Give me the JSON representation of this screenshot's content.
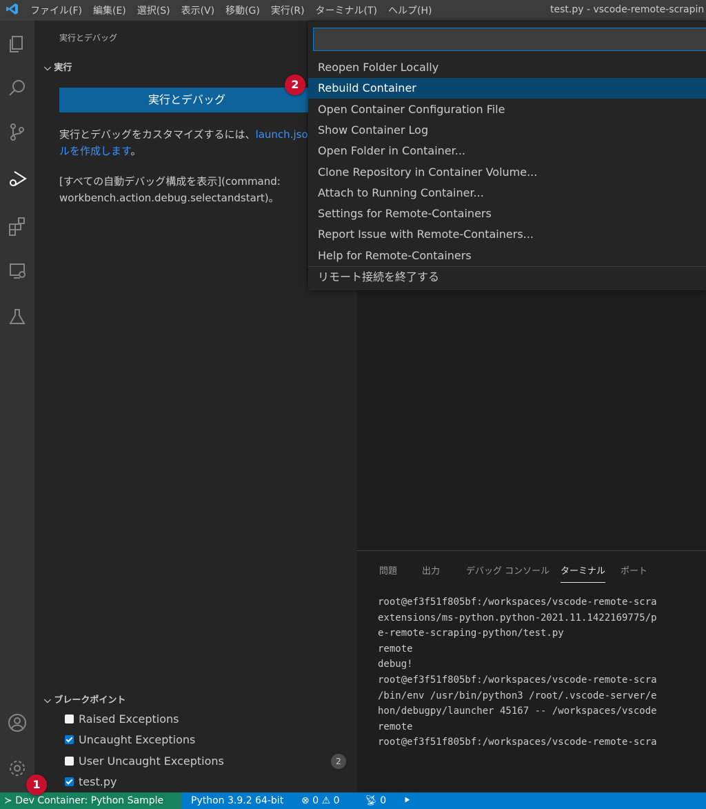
{
  "titlebar": {
    "menu": [
      "ファイル(F)",
      "編集(E)",
      "選択(S)",
      "表示(V)",
      "移動(G)",
      "実行(R)",
      "ターミナル(T)",
      "ヘルプ(H)"
    ],
    "window_title": "test.py - vscode-remote-scrapin"
  },
  "activitybar": {
    "icons": [
      "explorer-icon",
      "search-icon",
      "source-control-icon",
      "run-debug-icon",
      "extensions-icon",
      "remote-explorer-icon",
      "testing-icon",
      "account-icon",
      "settings-gear-icon"
    ]
  },
  "sidebar": {
    "title": "実行とデバッグ",
    "run_section": "実行",
    "run_button": "実行とデバッグ",
    "customize_text": "実行とデバッグをカスタマイズするには、",
    "customize_link": "launch.json",
    "customize_link_cont": "ルを作成します",
    "customize_suffix": "。",
    "show_all_text": "[すべての自動デバッグ構成を表示](command:",
    "show_all_cmd": "workbench.action.debug.selectandstart)。",
    "breakpoints_section": "ブレークポイント",
    "breakpoints": [
      {
        "label": "Raised Exceptions",
        "checked": false
      },
      {
        "label": "Uncaught Exceptions",
        "checked": true
      },
      {
        "label": "User Uncaught Exceptions",
        "checked": false
      },
      {
        "label": "test.py",
        "checked": true
      }
    ],
    "breakpoint_count": "2"
  },
  "quickpick": {
    "input_value": "",
    "items": [
      "Reopen Folder Locally",
      "Rebuild Container",
      "Open Container Configuration File",
      "Show Container Log",
      "Open Folder in Container...",
      "Clone Repository in Container Volume...",
      "Attach to Running Container...",
      "Settings for Remote-Containers",
      "Report Issue with Remote-Containers...",
      "Help for Remote-Containers",
      "リモート接続を終了する"
    ],
    "selected_index": 1
  },
  "panel": {
    "tabs": [
      "問題",
      "出力",
      "デバッグ コンソール",
      "ターミナル",
      "ポート"
    ],
    "active_tab": "ターミナル",
    "terminal_lines": [
      "root@ef3f51f805bf:/workspaces/vscode-remote-scra",
      "extensions/ms-python.python-2021.11.1422169775/p",
      "e-remote-scraping-python/test.py",
      "remote",
      "debug!",
      "root@ef3f51f805bf:/workspaces/vscode-remote-scra",
      "/bin/env /usr/bin/python3 /root/.vscode-server/e",
      "hon/debugpy/launcher 45167 -- /workspaces/vscode",
      "remote",
      "root@ef3f51f805bf:/workspaces/vscode-remote-scra"
    ]
  },
  "statusbar": {
    "remote": "Dev Container: Python Sample",
    "python": "Python 3.9.2 64-bit",
    "errors": "0",
    "warnings": "0",
    "ports": "0"
  },
  "annotations": [
    "1",
    "2"
  ],
  "colors": {
    "accent": "#007acc",
    "remote_indicator": "#16825d",
    "selection": "#094771",
    "badge": "#c8102e"
  }
}
